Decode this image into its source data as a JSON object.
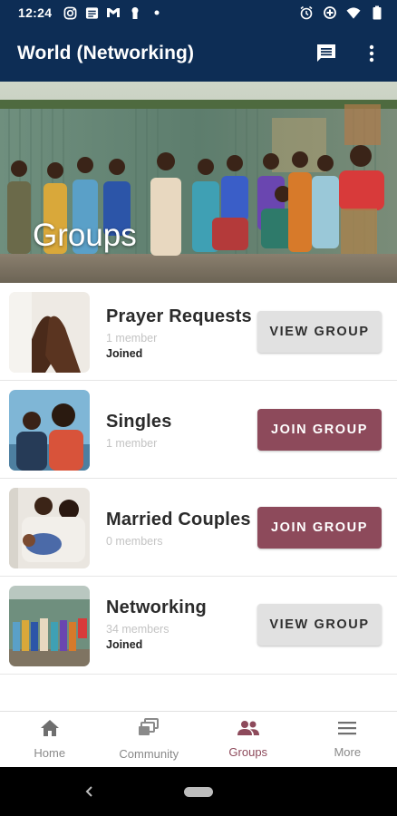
{
  "status_bar": {
    "time": "12:24",
    "left_icons": [
      "instagram-icon",
      "message-icon",
      "gmail-icon",
      "keyhole-icon",
      "dot-icon"
    ],
    "right_icons": [
      "alarm-icon",
      "data-saver-icon",
      "wifi-icon",
      "battery-icon"
    ]
  },
  "app_bar": {
    "title": "World (Networking)",
    "actions": [
      "chat-icon",
      "more-vert-icon"
    ]
  },
  "hero": {
    "title": "Groups"
  },
  "groups": [
    {
      "name": "Prayer Requests",
      "members": "1 member",
      "status": "Joined",
      "button": "VIEW GROUP",
      "button_type": "view"
    },
    {
      "name": "Singles",
      "members": "1 member",
      "status": "",
      "button": "JOIN GROUP",
      "button_type": "join"
    },
    {
      "name": "Married Couples",
      "members": "0 members",
      "status": "",
      "button": "JOIN GROUP",
      "button_type": "join"
    },
    {
      "name": "Networking",
      "members": "34 members",
      "status": "Joined",
      "button": "VIEW GROUP",
      "button_type": "view"
    }
  ],
  "bottom_nav": [
    {
      "label": "Home",
      "icon": "home-icon",
      "active": false
    },
    {
      "label": "Community",
      "icon": "community-icon",
      "active": false
    },
    {
      "label": "Groups",
      "icon": "groups-icon",
      "active": true
    },
    {
      "label": "More",
      "icon": "menu-icon",
      "active": false
    }
  ],
  "colors": {
    "app_bar": "#0d2d55",
    "join_button": "#8d4a5b",
    "view_button": "#e1e1e1",
    "active_nav": "#8d4a5b"
  }
}
